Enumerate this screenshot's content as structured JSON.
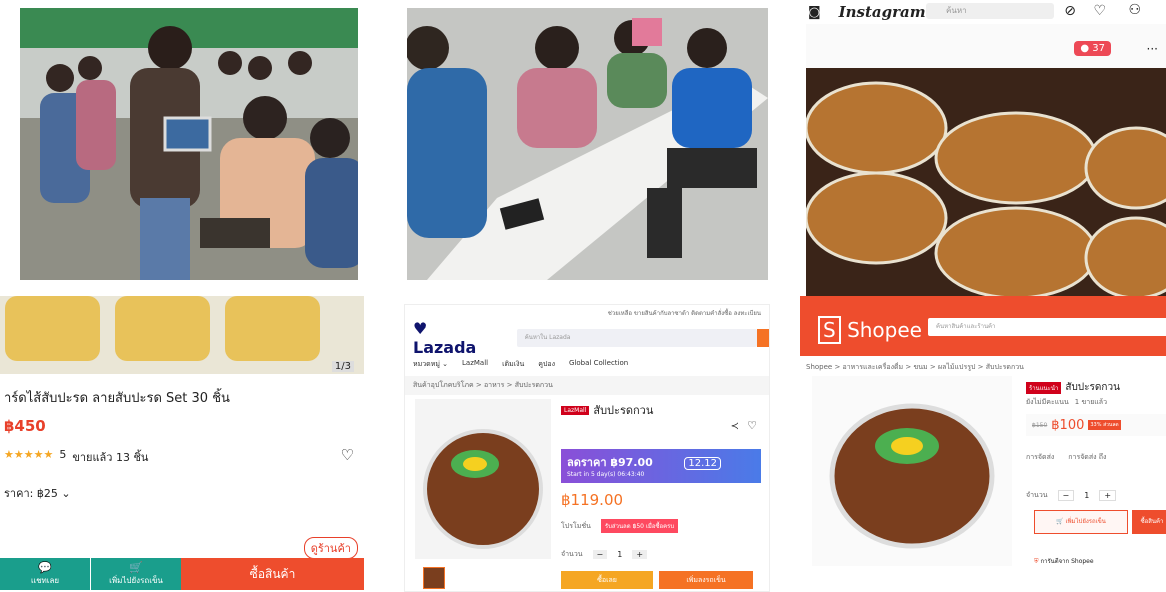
{
  "instagram": {
    "brand": "Instagram",
    "search_placeholder": "ค้นหา",
    "likes_badge": "37",
    "icons": [
      "compass-icon",
      "heart-icon",
      "user-icon"
    ]
  },
  "mobile_shop": {
    "product_title": "าร์ดไส้สับปะรด ลายสับปะรด Set 30 ชิ้น",
    "price": "฿450",
    "image_counter": "1/3",
    "rating_stars": "★★★★★",
    "rating_value": "5",
    "sold_text": "ขายแล้ว 13 ชิ้น",
    "variant_price": "ราคา: ฿25",
    "shop_button": "ดูร้านค้า",
    "chat_label": "แชทเลย",
    "cart_label": "เพิ่มไปยังรถเข็น",
    "buy_label": "ซื้อสินค้า"
  },
  "lazada": {
    "logo": "Lazada",
    "top_links": "ช่วยเหลือ  ขายสินค้ากับลาซาด้า  ติดตามคำสั่งซื้อ  ลงทะเบียน",
    "search_placeholder": "ค้นหาใน Lazada",
    "nav_items": [
      "LazMall",
      "เติมเงิน",
      "คูปอง",
      "Global Collection"
    ],
    "breadcrumb": "สินค้าอุปโภคบริโภค > อาหาร > สับปะรดกวน",
    "mall_tag": "LazMall",
    "product_title": "สับปะรดกวน",
    "sale_price_label": "ลดราคา ฿97.00",
    "sale_sub": "Start in 5 day(s) 06:43:40",
    "promo_label": "12.12",
    "price": "฿119.00",
    "promotion_label": "โปรโมชั่น",
    "promotion_text": "รับส่วนลด ฿50 เมื่อซื้อครบ",
    "quantity_label": "จำนวน",
    "quantity": "1",
    "buy_now": "ซื้อเลย",
    "add_to_cart": "เพิ่มลงรถเข็น"
  },
  "shopee": {
    "logo": "Shopee",
    "search_placeholder": "ค้นหาสินค้าและร้านค้า",
    "breadcrumb": "Shopee > อาหารและเครื่องดื่ม > ขนม > ผลไม้แปรรูป > สับปะรดกวน",
    "preferred_tag": "ร้านแนะนำ",
    "product_title": "สับปะรดกวน",
    "no_ratings": "ยังไม่มีคะแนน",
    "sold": "1 ขายแล้ว",
    "old_price": "฿150",
    "price": "฿100",
    "discount": "33% ส่วนลด",
    "shipping_label": "การจัดส่ง",
    "shipping_value": "การจัดส่ง ถึง",
    "quantity_label": "จำนวน",
    "quantity": "1",
    "add_to_cart": "เพิ่มไปยังรถเข็น",
    "buy_now": "ซื้อสินค้า",
    "guarantee": "การันตีจาก Shopee"
  },
  "colors": {
    "instagram_badge": "#ed4956",
    "shopee_orange": "#ee4d2d",
    "lazada_navy": "#0f146d",
    "lazada_orange": "#f57224",
    "mobile_green": "#1a9e8c"
  }
}
